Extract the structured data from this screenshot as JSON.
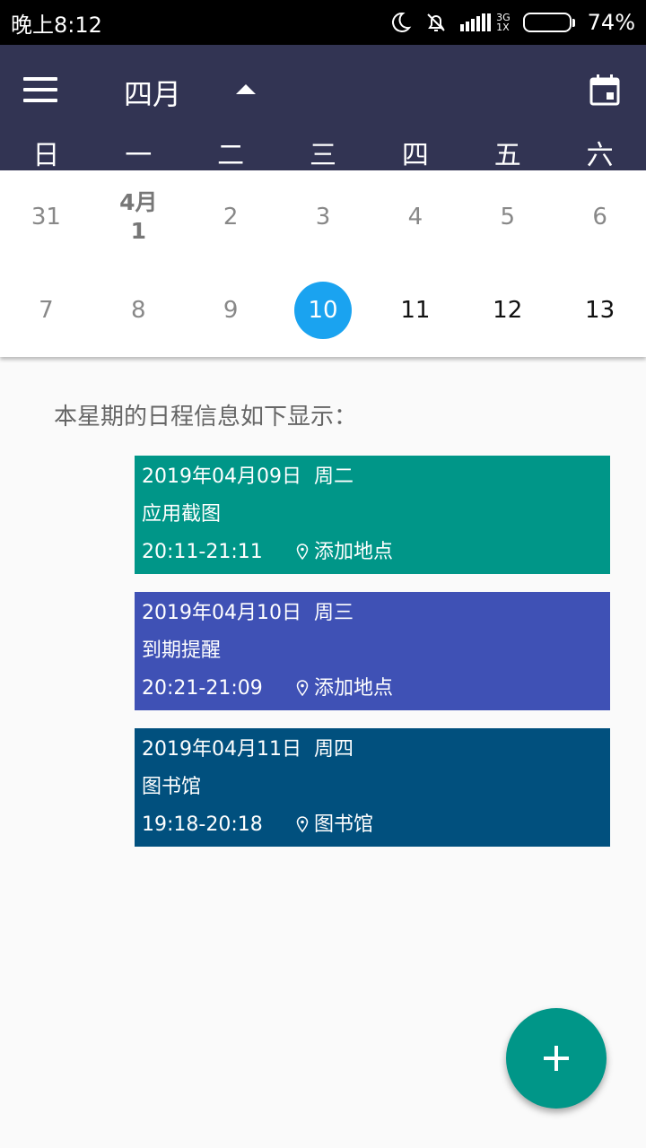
{
  "status_bar": {
    "time": "晚上8:12",
    "network_top": "3G",
    "network_bottom": "1X",
    "battery": "74%",
    "battery_level": 0.74
  },
  "toolbar": {
    "month": "四月",
    "weekdays": [
      "日",
      "一",
      "二",
      "三",
      "四",
      "五",
      "六"
    ]
  },
  "calendar": {
    "week1": [
      {
        "label": "31"
      },
      {
        "label_top": "4月",
        "label": "1"
      },
      {
        "label": "2"
      },
      {
        "label": "3"
      },
      {
        "label": "4"
      },
      {
        "label": "5"
      },
      {
        "label": "6"
      }
    ],
    "week2": [
      {
        "label": "7"
      },
      {
        "label": "8"
      },
      {
        "label": "9"
      },
      {
        "label": "10"
      },
      {
        "label": "11"
      },
      {
        "label": "12"
      },
      {
        "label": "13"
      }
    ],
    "selected_day": "10",
    "accent_color": "#1aa3f0"
  },
  "schedule": {
    "heading": "本星期的日程信息如下显示：",
    "events": [
      {
        "date": "2019年04月09日",
        "weekday": "周二",
        "title": "应用截图",
        "time": "20:11-21:11",
        "location": "添加地点",
        "color": "#009688"
      },
      {
        "date": "2019年04月10日",
        "weekday": "周三",
        "title": "到期提醒",
        "time": "20:21-21:09",
        "location": "添加地点",
        "color": "#3f51b5"
      },
      {
        "date": "2019年04月11日",
        "weekday": "周四",
        "title": "图书馆",
        "time": "19:18-20:18",
        "location": "图书馆",
        "color": "#01507e"
      }
    ]
  },
  "fab": {
    "icon": "plus-icon",
    "color": "#009688"
  }
}
